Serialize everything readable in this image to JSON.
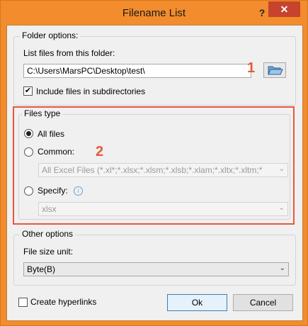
{
  "window": {
    "title": "Filename List",
    "help_label": "?",
    "close_label": "✕"
  },
  "folder_options": {
    "group_label": "Folder options:",
    "list_label": "List files from this folder:",
    "folder_path": "C:\\Users\\MarsPC\\Desktop\\test\\",
    "include_subdirs_label": "Include files in subdirectories",
    "include_subdirs_checked": true
  },
  "files_type": {
    "group_label": "Files type",
    "all_files_label": "All files",
    "common_label": "Common:",
    "common_value": "All Excel Files (*.xl*;*.xlsx;*.xlsm;*.xlsb;*.xlam;*.xltx;*.xltm;*",
    "specify_label": "Specify:",
    "specify_value": "xlsx",
    "selected": "All files"
  },
  "other_options": {
    "group_label": "Other options",
    "file_size_unit_label": "File size unit:",
    "file_size_unit_value": "Byte(B)"
  },
  "footer": {
    "create_hyperlinks_label": "Create hyperlinks",
    "create_hyperlinks_checked": false,
    "ok_label": "Ok",
    "cancel_label": "Cancel"
  },
  "annotations": {
    "badge_1": "1",
    "badge_2": "2"
  },
  "icons": {
    "folder": "folder-open-icon",
    "info": "info-icon",
    "dropdown": "chevron-down-icon"
  },
  "colors": {
    "titlebar": "#f28c2c",
    "close_button": "#c7432d",
    "annotation": "#e8573d"
  }
}
